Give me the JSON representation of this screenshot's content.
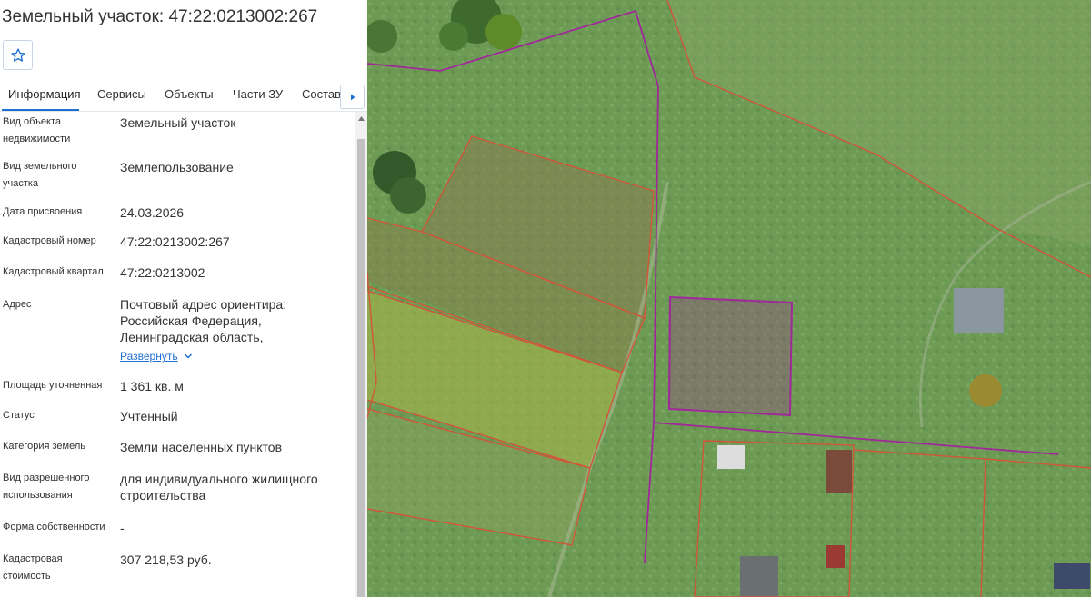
{
  "title": "Земельный участок: 47:22:0213002:267",
  "favorite_icon": "star-outline-icon",
  "tabs": [
    {
      "label": "Информация",
      "active": true
    },
    {
      "label": "Сервисы",
      "active": false
    },
    {
      "label": "Объекты",
      "active": false
    },
    {
      "label": "Части ЗУ",
      "active": false
    },
    {
      "label": "Состав",
      "active": false
    }
  ],
  "tab_more_icon": "chevron-right-icon",
  "properties": [
    {
      "label": "Вид объекта недвижимости",
      "value": "Земельный участок"
    },
    {
      "label": "Вид земельного участка",
      "value": "Землепользование"
    },
    {
      "label": "Дата присвоения",
      "value": "24.03.2026"
    },
    {
      "label": "Кадастровый номер",
      "value": "47:22:0213002:267"
    },
    {
      "label": "Кадастровый квартал",
      "value": "47:22:0213002"
    },
    {
      "label": "Адрес",
      "value": "Почтовый адрес ориентира: Российская Федерация, Ленинградская область,"
    },
    {
      "label": "Площадь уточненная",
      "value": "1 361 кв. м"
    },
    {
      "label": "Статус",
      "value": "Учтенный"
    },
    {
      "label": "Категория земель",
      "value": "Земли населенных пунктов"
    },
    {
      "label": "Вид разрешенного использования",
      "value": "для индивидуального жилищного строительства"
    },
    {
      "label": "Форма собственности",
      "value": "-"
    },
    {
      "label": "Кадастровая стоимость",
      "value": "307 218,53 руб."
    }
  ],
  "address_expand_label": "Развернуть",
  "colors": {
    "accent": "#1f6fd1",
    "selected_parcel": "#a0289a",
    "parcel_border": "#d2553a"
  }
}
